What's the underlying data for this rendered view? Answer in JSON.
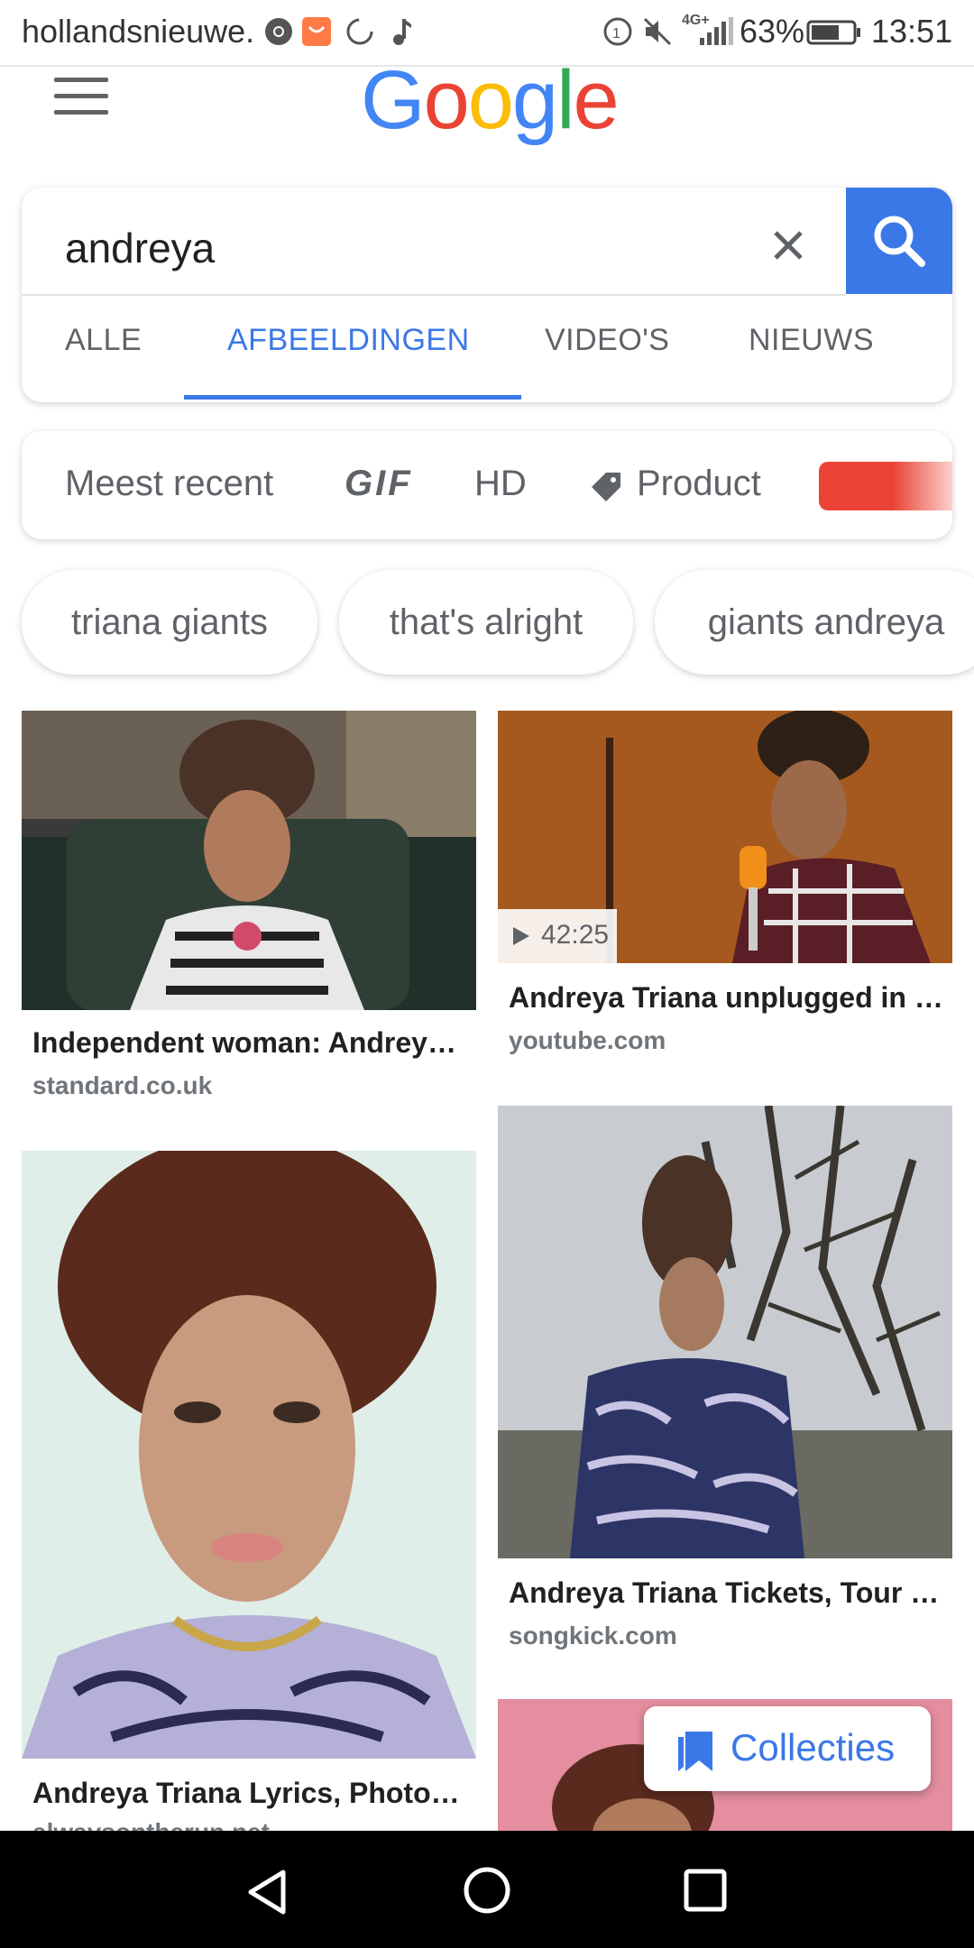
{
  "status_bar": {
    "app_text": "hollandsnieuwe.",
    "battery": "63%",
    "time": "13:51",
    "network": "4G+"
  },
  "header": {
    "logo_text": "Google"
  },
  "search": {
    "query": "andreya"
  },
  "tabs": [
    {
      "label": "ALLE"
    },
    {
      "label": "AFBEELDINGEN"
    },
    {
      "label": "VIDEO'S"
    },
    {
      "label": "NIEUWS"
    }
  ],
  "filters": {
    "recent": "Meest recent",
    "gif": "GIF",
    "hd": "HD",
    "product": "Product"
  },
  "suggestions": [
    {
      "label": "triana giants"
    },
    {
      "label": "that's alright"
    },
    {
      "label": "giants andreya"
    }
  ],
  "results": [
    {
      "title": "Independent woman: Andreya…",
      "source": "standard.co.uk"
    },
    {
      "title": "Andreya Triana unplugged in …",
      "source": "youtube.com",
      "duration": "42:25"
    },
    {
      "title": "Andreya Triana Lyrics, Photos…",
      "source": "alwaysontherun.net"
    },
    {
      "title": "Andreya Triana Tickets, Tour …",
      "source": "songkick.com"
    }
  ],
  "collecties": {
    "label": "Collecties"
  },
  "colors": {
    "accent": "#3b78e7",
    "red": "#ea4335",
    "text_gray": "#5f6368"
  },
  "icons": [
    "menu-icon",
    "clear-icon",
    "search-icon",
    "tag-icon",
    "play-icon",
    "bookmark-icon",
    "back-icon",
    "home-icon",
    "recents-icon"
  ]
}
